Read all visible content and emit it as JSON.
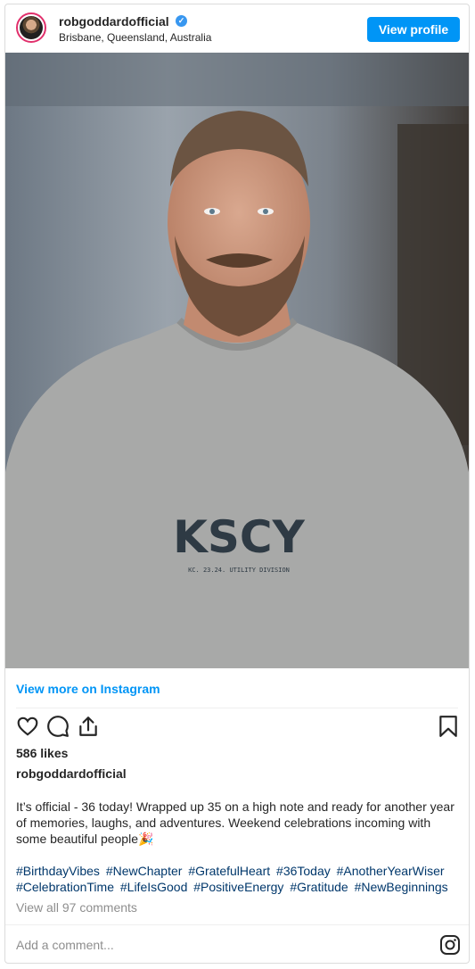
{
  "header": {
    "username": "robgoddardofficial",
    "location": "Brisbane, Queensland, Australia",
    "view_profile_label": "View profile",
    "verified_icon": "verified-badge-icon"
  },
  "photo": {
    "shirt_text": "KSCY",
    "shirt_subtext": "KC. 23.24. UTILITY DIVISION"
  },
  "view_more_label": "View more on Instagram",
  "actions": {
    "icons": [
      "heart-icon",
      "comment-icon",
      "share-icon",
      "bookmark-icon"
    ]
  },
  "likes": "586 likes",
  "caption": {
    "username": "robgoddardofficial",
    "text": "It’s official - 36 today! Wrapped up 35 on a high note and ready for another year of memories, laughs, and adventures. Weekend celebrations incoming with some beautiful people🎉"
  },
  "hashtags": [
    "#BirthdayVibes",
    "#NewChapter",
    "#GratefulHeart",
    "#36Today",
    "#AnotherYearWiser",
    "#CelebrationTime",
    "#LifeIsGood",
    "#PositiveEnergy",
    "#Gratitude",
    "#NewBeginnings"
  ],
  "comments_label": "View all 97 comments",
  "add_comment_placeholder": "Add a comment...",
  "colors": {
    "accent": "#0095f6",
    "hashtag": "#00376b",
    "muted": "#8e8e8e"
  }
}
